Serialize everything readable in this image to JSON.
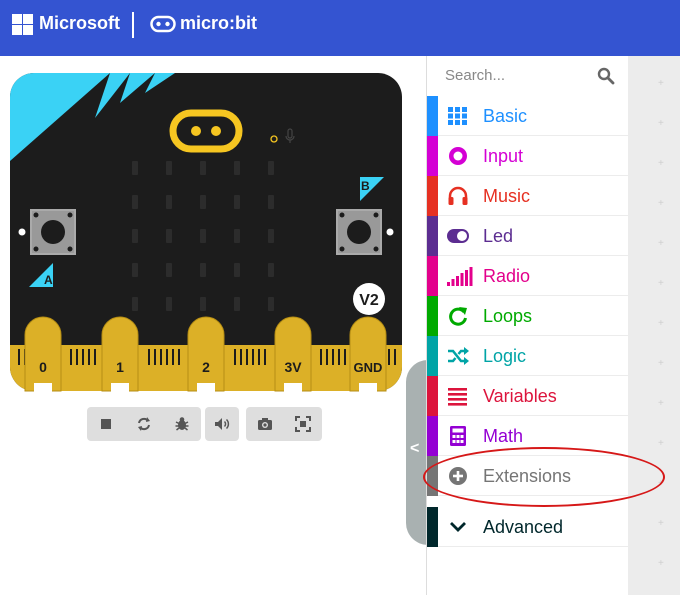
{
  "header": {
    "brand": "Microsoft",
    "product": "micro:bit",
    "background_color": "#3454d1"
  },
  "simulator": {
    "board_version": "V2",
    "button_a": "A",
    "button_b": "B",
    "pins": [
      "0",
      "1",
      "2",
      "3V",
      "GND"
    ],
    "toolbar_buttons": [
      {
        "name": "stop-icon"
      },
      {
        "name": "restart-icon"
      },
      {
        "name": "debug-icon"
      },
      {
        "name": "mute-icon"
      },
      {
        "name": "screenshot-icon"
      },
      {
        "name": "fullscreen-icon"
      }
    ]
  },
  "toolbox": {
    "search_placeholder": "Search...",
    "categories": [
      {
        "label": "Basic",
        "color": "#1e90ff",
        "icon": "grid-icon"
      },
      {
        "label": "Input",
        "color": "#d400d4",
        "icon": "target-icon"
      },
      {
        "label": "Music",
        "color": "#e63022",
        "icon": "headphones-icon"
      },
      {
        "label": "Led",
        "color": "#5c2d91",
        "icon": "toggle-icon"
      },
      {
        "label": "Radio",
        "color": "#e3008c",
        "icon": "signal-bars-icon"
      },
      {
        "label": "Loops",
        "color": "#00aa00",
        "icon": "refresh-icon"
      },
      {
        "label": "Logic",
        "color": "#00a4a6",
        "icon": "shuffle-icon"
      },
      {
        "label": "Variables",
        "color": "#dc143c",
        "icon": "lines-icon"
      },
      {
        "label": "Math",
        "color": "#9400d3",
        "icon": "calculator-icon"
      },
      {
        "label": "Extensions",
        "color": "#757575",
        "icon": "plus-circle-icon"
      },
      {
        "label": "Advanced",
        "color": "#00272b",
        "icon": "chevron-down-icon"
      }
    ]
  },
  "annotation": {
    "color": "#d61818"
  }
}
